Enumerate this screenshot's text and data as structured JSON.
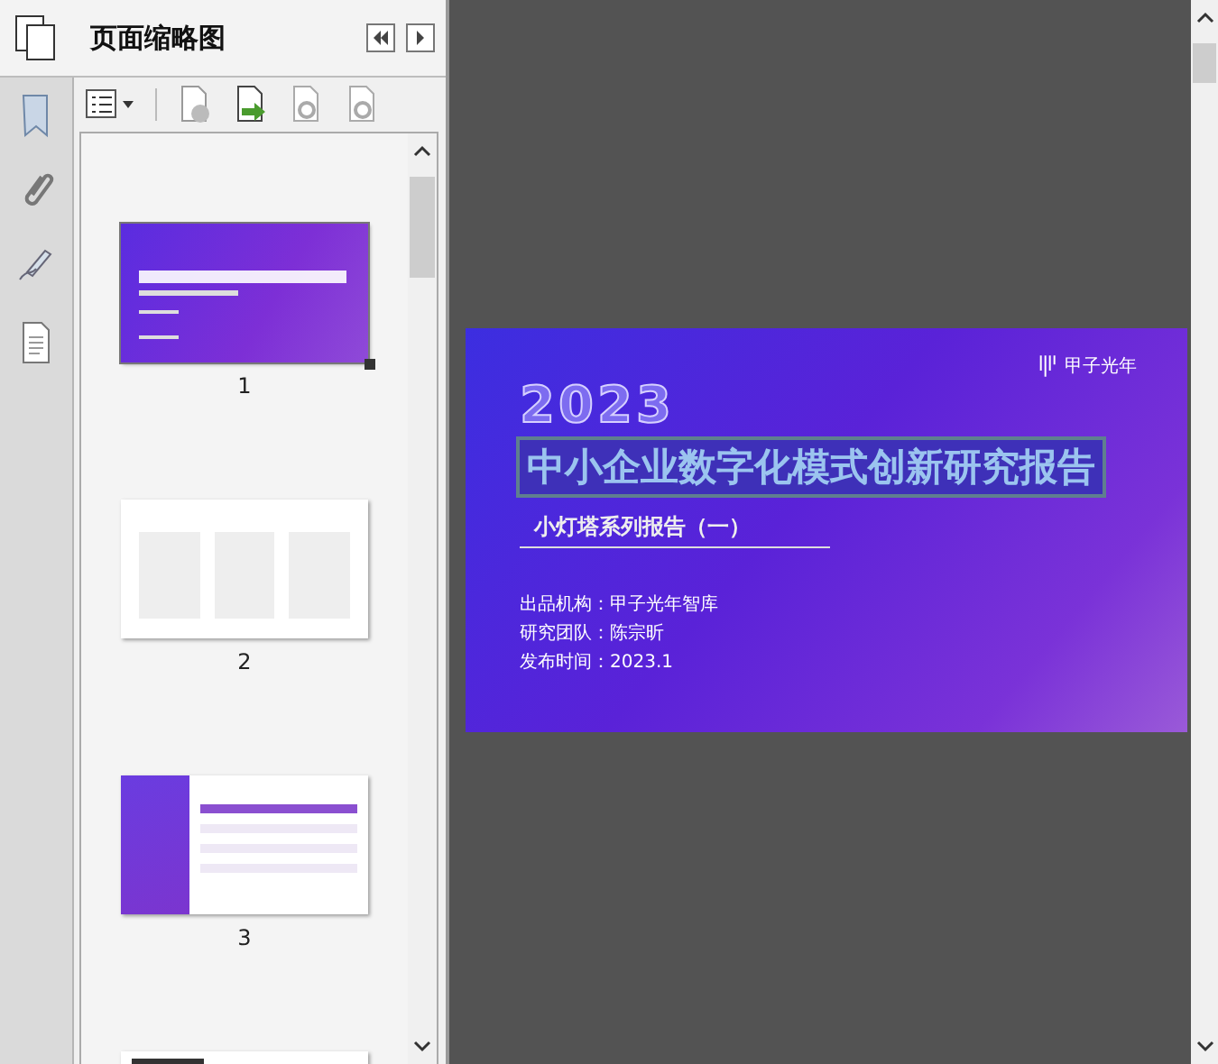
{
  "panel": {
    "title": "页面缩略图"
  },
  "thumbnails": [
    {
      "kind": "cover",
      "page": "1",
      "selected": true
    },
    {
      "kind": "cards",
      "page": "2",
      "selected": false
    },
    {
      "kind": "contents",
      "page": "3",
      "selected": false
    },
    {
      "kind": "partial",
      "selected": false
    }
  ],
  "slide": {
    "logo": "甲子光年",
    "year": "2023",
    "title": "中小企业数字化模式创新研究报告",
    "subtitle": "小灯塔系列报告（一）",
    "info": [
      "出品机构：甲子光年智库",
      "研究团队：陈宗昕",
      "发布时间：2023.1"
    ]
  }
}
